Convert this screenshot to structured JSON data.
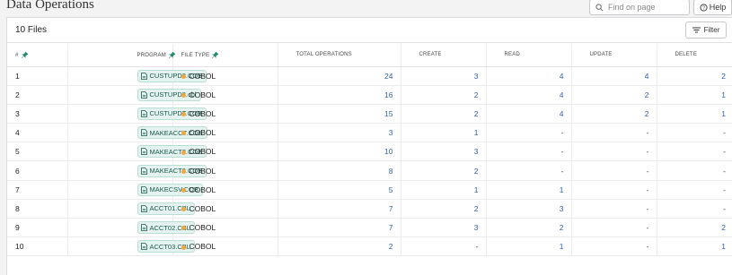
{
  "page": {
    "title": "Data Operations"
  },
  "search": {
    "placeholder": "Find on page"
  },
  "help": {
    "label": "Help"
  },
  "card": {
    "files_count": "10 Files",
    "filter_label": "Filter"
  },
  "table": {
    "columns": [
      "#",
      "PROGRAM",
      "FILE TYPE",
      "TOTAL OPERATIONS",
      "CREATE",
      "READ",
      "UPDATE",
      "DELETE"
    ],
    "rows": [
      {
        "idx": "1",
        "program": "CUSTUPD2.COB",
        "file_type": "COBOL",
        "total": "24",
        "create": "3",
        "read": "4",
        "update": "4",
        "delete": "2"
      },
      {
        "idx": "2",
        "program": "CUSTUPD3.cbl",
        "file_type": "COBOL",
        "total": "16",
        "create": "2",
        "read": "4",
        "update": "2",
        "delete": "1"
      },
      {
        "idx": "3",
        "program": "CUSTUPDT.COB",
        "file_type": "COBOL",
        "total": "15",
        "create": "2",
        "read": "4",
        "update": "2",
        "delete": "1"
      },
      {
        "idx": "4",
        "program": "MAKEACCT.COB",
        "file_type": "COBOL",
        "total": "3",
        "create": "1",
        "read": "-",
        "update": "-",
        "delete": "-"
      },
      {
        "idx": "5",
        "program": "MAKEACT2.COB",
        "file_type": "COBOL",
        "total": "10",
        "create": "3",
        "read": "-",
        "update": "-",
        "delete": "-"
      },
      {
        "idx": "6",
        "program": "MAKEACT3.COB",
        "file_type": "COBOL",
        "total": "8",
        "create": "2",
        "read": "-",
        "update": "-",
        "delete": "-"
      },
      {
        "idx": "7",
        "program": "MAKECSV.COB",
        "file_type": "COBOL",
        "total": "5",
        "create": "1",
        "read": "1",
        "update": "-",
        "delete": "-"
      },
      {
        "idx": "8",
        "program": "ACCT01.CBL",
        "file_type": "COBOL",
        "total": "7",
        "create": "2",
        "read": "3",
        "update": "-",
        "delete": "-"
      },
      {
        "idx": "9",
        "program": "ACCT02.CBL",
        "file_type": "COBOL",
        "total": "7",
        "create": "3",
        "read": "2",
        "update": "-",
        "delete": "2"
      },
      {
        "idx": "10",
        "program": "ACCT03.CBL",
        "file_type": "COBOL",
        "total": "2",
        "create": "-",
        "read": "1",
        "update": "-",
        "delete": "1"
      }
    ]
  },
  "colors": {
    "link": "#2f5fb2",
    "chip_bg": "#e4f3ef",
    "dot": "#f0a73b",
    "pin": "#1f8a72"
  },
  "icons": {
    "search": "search-icon",
    "help": "help-circle-icon",
    "filter": "filter-icon",
    "pin": "pin-icon",
    "file": "file-icon"
  }
}
